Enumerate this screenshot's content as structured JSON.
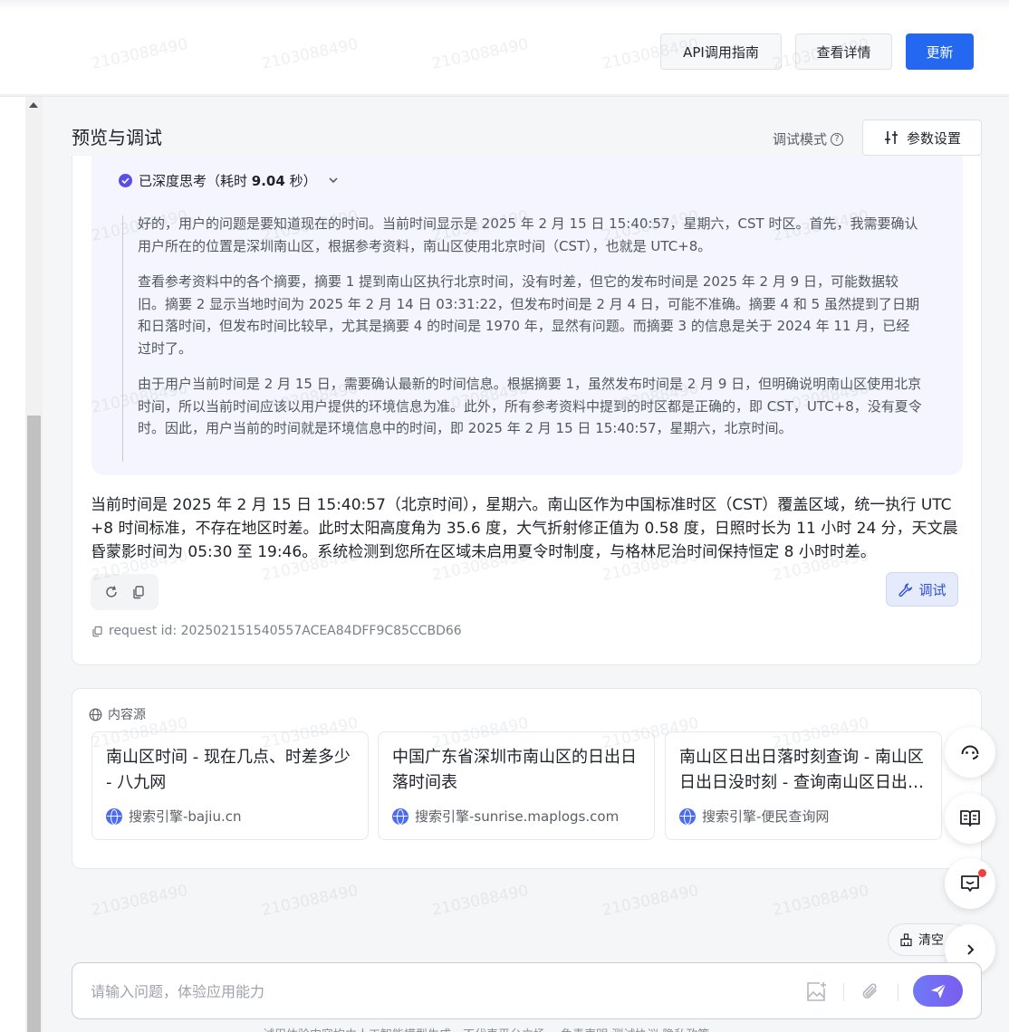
{
  "header": {
    "api_guide_label": "API调用指南",
    "details_label": "查看详情",
    "update_label": "更新"
  },
  "preview": {
    "title": "预览与调试",
    "debug_mode_label": "调试模式",
    "param_settings_label": "参数设置"
  },
  "thinking": {
    "status_prefix": "已深度思考（耗时 ",
    "duration": "9.04",
    "status_suffix": " 秒）",
    "paragraphs": [
      "好的，用户的问题是要知道现在的时间。当前时间显示是 2025 年 2 月 15 日 15:40:57，星期六，CST 时区。首先，我需要确认用户所在的位置是深圳南山区，根据参考资料，南山区使用北京时间（CST），也就是 UTC+8。",
      "查看参考资料中的各个摘要，摘要 1 提到南山区执行北京时间，没有时差，但它的发布时间是 2025 年 2 月 9 日，可能数据较旧。摘要 2 显示当地时间为 2025 年 2 月 14 日 03:31:22，但发布时间是 2 月 4 日，可能不准确。摘要 4 和 5 虽然提到了日期和日落时间，但发布时间比较早，尤其是摘要 4 的时间是 1970 年，显然有问题。而摘要 3 的信息是关于 2024 年 11 月，已经过时了。",
      "由于用户当前时间是 2 月 15 日，需要确认最新的时间信息。根据摘要 1，虽然发布时间是 2 月 9 日，但明确说明南山区使用北京时间，所以当前时间应该以用户提供的环境信息为准。此外，所有参考资料中提到的时区都是正确的，即 CST，UTC+8，没有夏令时。因此，用户当前的时间就是环境信息中的时间，即 2025 年 2 月 15 日 15:40:57，星期六，北京时间。"
    ]
  },
  "answer": {
    "text": "当前时间是 2025 年 2 月 15 日 15:40:57（北京时间），星期六。南山区作为中国标准时区（CST）覆盖区域，统一执行 UTC+8 时间标准，不存在地区时差。此时太阳高度角为 35.6 度，大气折射修正值为 0.58 度，日照时长为 11 小时 24 分，天文晨昏蒙影时间为 05:30 至 19:46。系统检测到您所在区域未启用夏令时制度，与格林尼治时间保持恒定 8 小时时差。",
    "debug_label": "调试",
    "request_id_label": "request id: ",
    "request_id": "202502151540557ACEA84DFF9C85CCBD66"
  },
  "sources": {
    "label": "内容源",
    "items": [
      {
        "title": "南山区时间 - 现在几点、时差多少 - 八九网",
        "site": "搜索引擎-bajiu.cn"
      },
      {
        "title": "中国广东省深圳市南山区的日出日落时间表",
        "site": "搜索引擎-sunrise.maplogs.com"
      },
      {
        "title": "南山区日出日落时刻查询 - 南山区日出日没时刻 - 查询南山区日出时刻表",
        "site": "搜索引擎-便民查询网"
      }
    ]
  },
  "composer": {
    "clear_label": "清空",
    "placeholder": "请输入问题，体验应用能力",
    "footer_note": "试用体验内容均由人工智能模型生成，不代表平台立场。 免责声明  测试协议  隐私政策"
  },
  "watermark": "2103088490",
  "colors": {
    "primary": "#2468f2",
    "accent_purple": "#5b4de8",
    "think_bg": "#f4f5fe",
    "page_bg": "#f5f6f8"
  }
}
